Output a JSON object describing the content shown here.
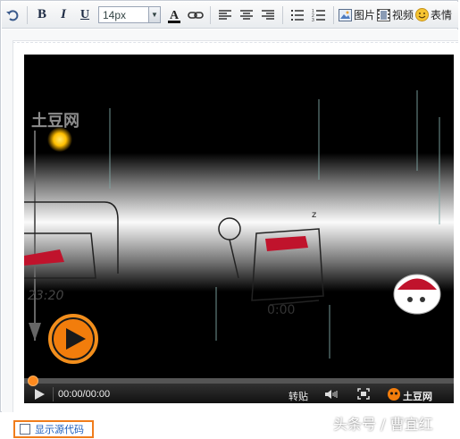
{
  "toolbar": {
    "font_size": "14px",
    "image_label": "图片",
    "video_label": "视频",
    "emoji_label": "表情"
  },
  "video": {
    "site_logo": "土豆网",
    "time_display": "00:00/00:00",
    "repost_label": "转贴",
    "brand_label": "土豆网",
    "scene_timestamp_left": "23:20",
    "scene_timestamp_center": "0:00"
  },
  "footer": {
    "show_source_label": "显示源代码",
    "watermark": "头条号 / 曹宜红"
  },
  "colors": {
    "accent_orange": "#f07d1c",
    "link_blue": "#1e5fbd"
  }
}
